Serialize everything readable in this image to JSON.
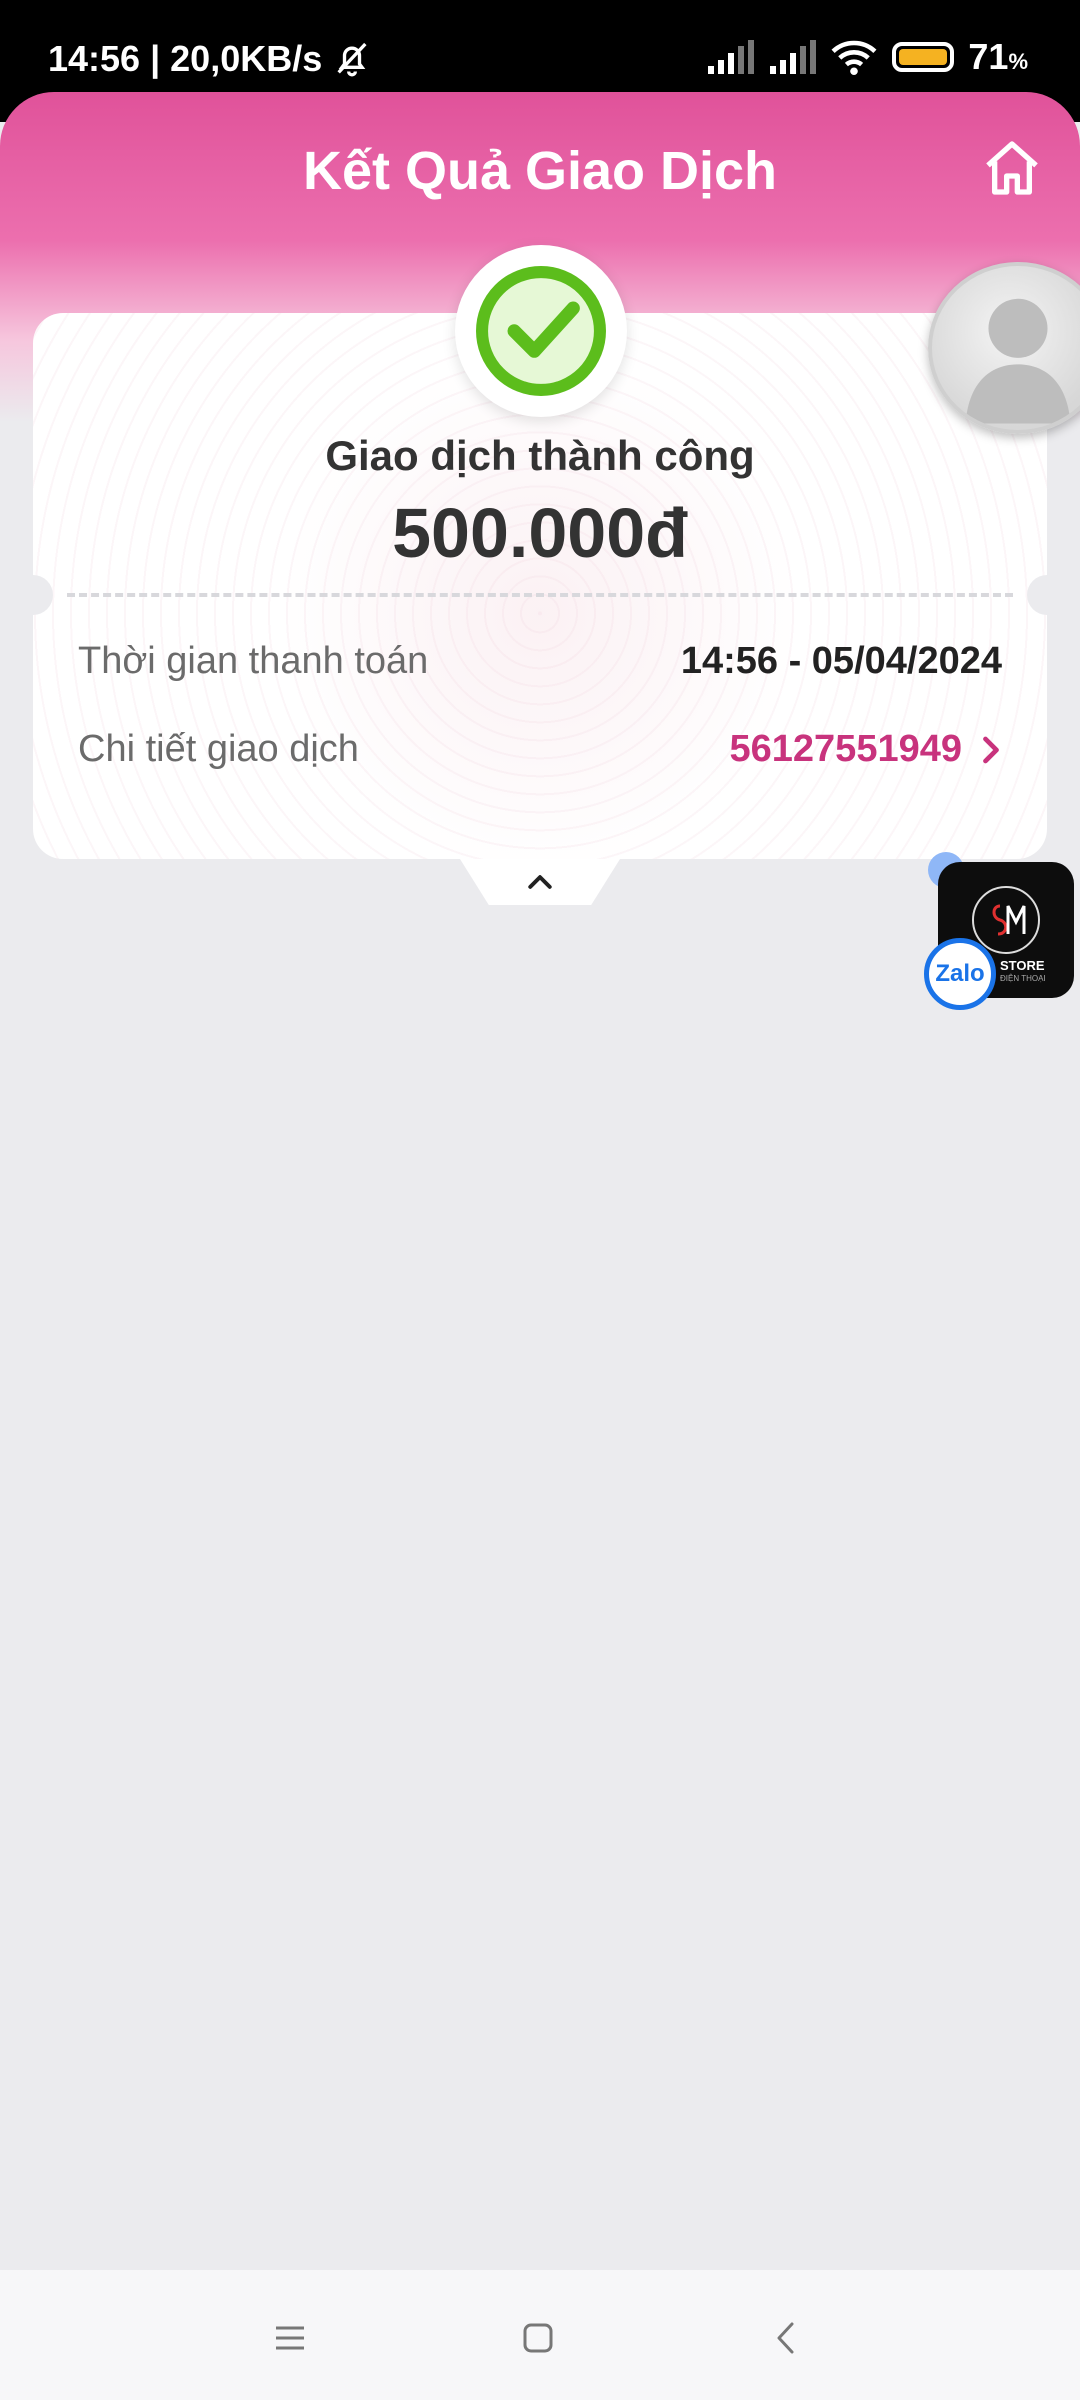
{
  "status_bar": {
    "time_speed": "14:56 | 20,0KB/s",
    "battery_pct": "71",
    "battery_unit": "%",
    "battery_level": 0.71
  },
  "header": {
    "title": "Kết Quả Giao Dịch",
    "home_icon": "home-icon"
  },
  "result": {
    "status": "Giao dịch thành công",
    "amount": "500.000đ",
    "rows": [
      {
        "label": "Thời gian thanh toán",
        "value": "14:56 - 05/04/2024"
      },
      {
        "label": "Chi tiết giao dịch",
        "value": "56127551949"
      }
    ]
  },
  "floating": {
    "store_name": "STORE",
    "store_sub": "ĐIỆN THOẠI",
    "zalo_label": "Zalo"
  },
  "colors": {
    "accent": "#c8337d",
    "header_pink": "#e0529a",
    "success_green": "#5cbd1c"
  }
}
